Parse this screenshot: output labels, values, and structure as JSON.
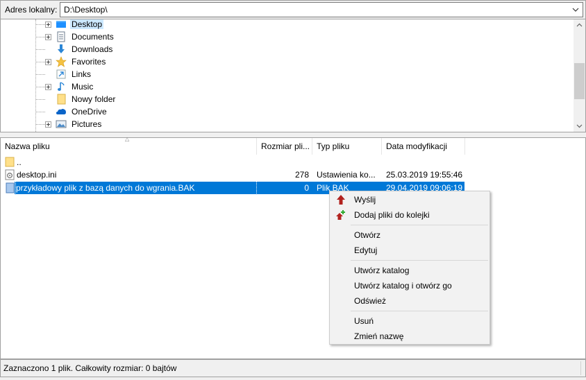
{
  "address": {
    "label": "Adres lokalny:",
    "value": "D:\\Desktop\\"
  },
  "tree": {
    "items": [
      {
        "label": "Desktop",
        "icon": "desktop-folder-icon",
        "expandable": true,
        "selected": true
      },
      {
        "label": "Documents",
        "icon": "documents-icon",
        "expandable": true
      },
      {
        "label": "Downloads",
        "icon": "downloads-icon",
        "expandable": false
      },
      {
        "label": "Favorites",
        "icon": "favorites-icon",
        "expandable": true
      },
      {
        "label": "Links",
        "icon": "links-icon",
        "expandable": false
      },
      {
        "label": "Music",
        "icon": "music-icon",
        "expandable": true
      },
      {
        "label": "Nowy folder",
        "icon": "folder-icon",
        "expandable": false
      },
      {
        "label": "OneDrive",
        "icon": "onedrive-icon",
        "expandable": false
      },
      {
        "label": "Pictures",
        "icon": "pictures-icon",
        "expandable": true
      }
    ]
  },
  "list": {
    "columns": [
      "Nazwa pliku",
      "Rozmiar pli...",
      "Typ pliku",
      "Data modyfikacji"
    ],
    "rows": [
      {
        "name": "..",
        "size": "",
        "type": "",
        "modified": "",
        "icon": "parent-folder-icon"
      },
      {
        "name": "desktop.ini",
        "size": "278",
        "type": "Ustawienia ko...",
        "modified": "25.03.2019 19:55:46",
        "icon": "ini-file-icon"
      },
      {
        "name": "przykładowy plik z bazą danych do wgrania.BAK",
        "size": "0",
        "type": "Plik BAK",
        "modified": "29.04.2019 09:06:19",
        "icon": "bak-file-icon",
        "selected": true
      }
    ]
  },
  "context_menu": {
    "items": [
      {
        "label": "Wyślij",
        "icon": "upload-arrow-icon"
      },
      {
        "label": "Dodaj pliki do kolejki",
        "icon": "add-to-queue-icon"
      },
      {
        "label": "Otwórz"
      },
      {
        "label": "Edytuj"
      },
      {
        "label": "Utwórz katalog"
      },
      {
        "label": "Utwórz katalog i otwórz go"
      },
      {
        "label": "Odśwież"
      },
      {
        "label": "Usuń"
      },
      {
        "label": "Zmień nazwę"
      }
    ]
  },
  "status": {
    "text": "Zaznaczono 1 plik. Całkowity rozmiar: 0 bajtów"
  },
  "colors": {
    "selection": "#0078d7",
    "tree_selection": "#cce8ff",
    "menu_bg": "#f2f2f2"
  }
}
